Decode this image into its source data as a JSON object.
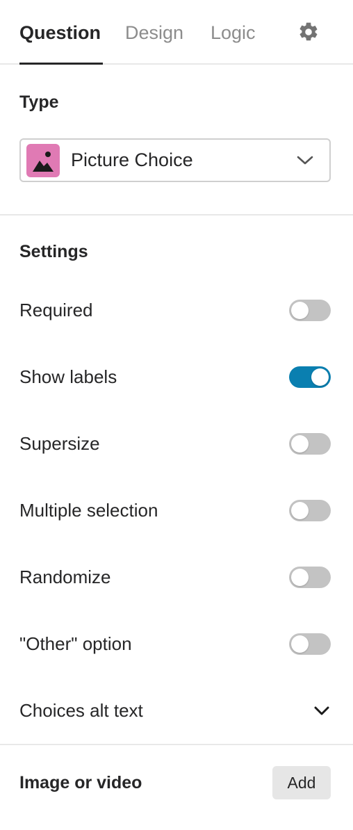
{
  "tabs": [
    {
      "label": "Question",
      "active": true
    },
    {
      "label": "Design",
      "active": false
    },
    {
      "label": "Logic",
      "active": false
    }
  ],
  "settings_icon": "gear-icon",
  "type_section": {
    "title": "Type",
    "selected": "Picture Choice",
    "icon": "picture-icon",
    "icon_color": "#e07ab4"
  },
  "settings_section": {
    "title": "Settings",
    "items": [
      {
        "label": "Required",
        "enabled": false
      },
      {
        "label": "Show labels",
        "enabled": true
      },
      {
        "label": "Supersize",
        "enabled": false
      },
      {
        "label": "Multiple selection",
        "enabled": false
      },
      {
        "label": "Randomize",
        "enabled": false
      },
      {
        "label": "\"Other\" option",
        "enabled": false
      }
    ],
    "alt_text": {
      "label": "Choices alt text",
      "icon": "chevron-down-icon"
    }
  },
  "media_section": {
    "title": "Image or video",
    "button_label": "Add"
  },
  "colors": {
    "toggle_on": "#0a7fb0",
    "toggle_off": "#c3c3c3",
    "text": "#262627",
    "muted": "#8c8c8c"
  }
}
